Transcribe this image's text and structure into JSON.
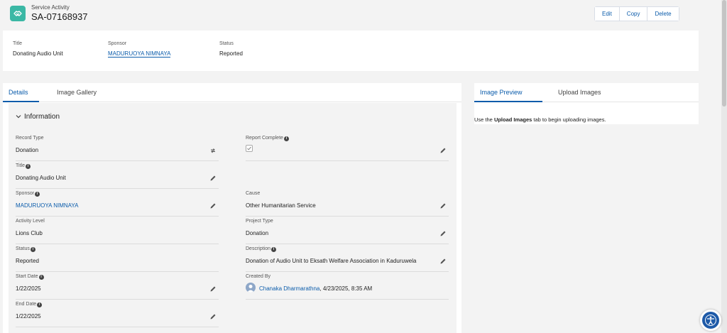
{
  "header": {
    "object_label": "Service Activity",
    "record_name": "SA-07168937",
    "actions": [
      "Edit",
      "Copy",
      "Delete"
    ],
    "icon": "handshake-icon",
    "icon_color": "#3bb8a5"
  },
  "highlights": {
    "title_label": "Title",
    "title_value": "Donating Audio Unit",
    "sponsor_label": "Sponsor",
    "sponsor_value": "MADURUOYA NIMNAYA",
    "status_label": "Status",
    "status_value": "Reported"
  },
  "tabs": {
    "details": "Details",
    "gallery": "Image Gallery"
  },
  "section": {
    "title": "Information"
  },
  "fields": {
    "record_type": {
      "label": "Record Type",
      "value": "Donation"
    },
    "report_complete": {
      "label": "Report Complete",
      "checked": true
    },
    "title": {
      "label": "Title",
      "value": "Donating Audio Unit"
    },
    "sponsor": {
      "label": "Sponsor",
      "value": "MADURUOYA NIMNAYA"
    },
    "cause": {
      "label": "Cause",
      "value": "Other Humanitarian Service"
    },
    "activity_level": {
      "label": "Activity Level",
      "value": "Lions Club"
    },
    "project_type": {
      "label": "Project Type",
      "value": "Donation"
    },
    "status": {
      "label": "Status",
      "value": "Reported"
    },
    "description": {
      "label": "Description",
      "value": "Donation of Audio Unit to Eksath Welfare Association in Kaduruwela"
    },
    "start_date": {
      "label": "Start Date",
      "value": "1/22/2025"
    },
    "created_by": {
      "label": "Created By",
      "user": "Chanaka Dharmarathna",
      "date": ", 4/23/2025, 8:35 AM"
    },
    "end_date": {
      "label": "End Date",
      "value": "1/22/2025"
    }
  },
  "image_panel": {
    "tab_preview": "Image Preview",
    "tab_upload": "Upload Images",
    "hint_before": "Use the ",
    "hint_bold": "Upload Images",
    "hint_after": " tab to begin uploading images."
  },
  "colors": {
    "brand_blue": "#0b5cab",
    "accessibility_button": "#1e5aa8"
  }
}
